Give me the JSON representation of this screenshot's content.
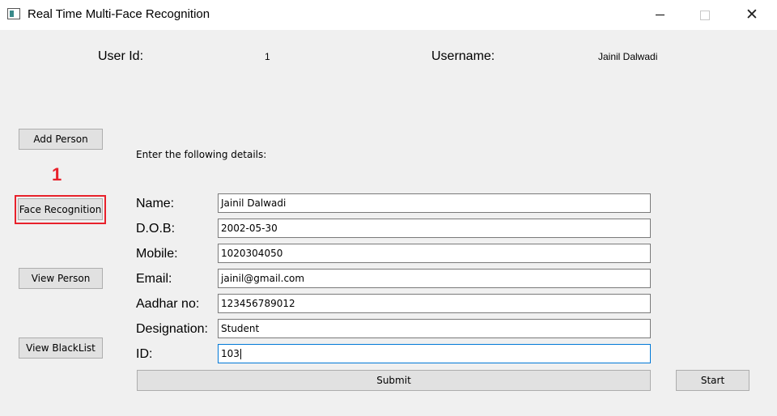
{
  "window": {
    "title": "Real Time Multi-Face Recognition",
    "controls": {
      "minimize": "minimize",
      "maximize": "maximize",
      "close": "✕"
    }
  },
  "header": {
    "user_id_label": "User Id:",
    "user_id_value": "1",
    "username_label": "Username:",
    "username_value": "Jainil Dalwadi"
  },
  "sidebar": {
    "add_person": "Add Person",
    "face_recognition": "Face Recognition",
    "view_person": "View Person",
    "view_blacklist": "View BlackList"
  },
  "annotation": {
    "marker": "1",
    "color": "#e8212b"
  },
  "form": {
    "instructions": "Enter the following details:",
    "fields": [
      {
        "label": "Name:",
        "value": "Jainil Dalwadi"
      },
      {
        "label": "D.O.B:",
        "value": "2002-05-30"
      },
      {
        "label": "Mobile:",
        "value": "1020304050"
      },
      {
        "label": "Email:",
        "value": "jainil@gmail.com"
      },
      {
        "label": "Aadhar no:",
        "value": "123456789012"
      },
      {
        "label": "Designation:",
        "value": "Student"
      },
      {
        "label": "ID:",
        "value": "103"
      }
    ],
    "submit": "Submit",
    "start": "Start"
  }
}
